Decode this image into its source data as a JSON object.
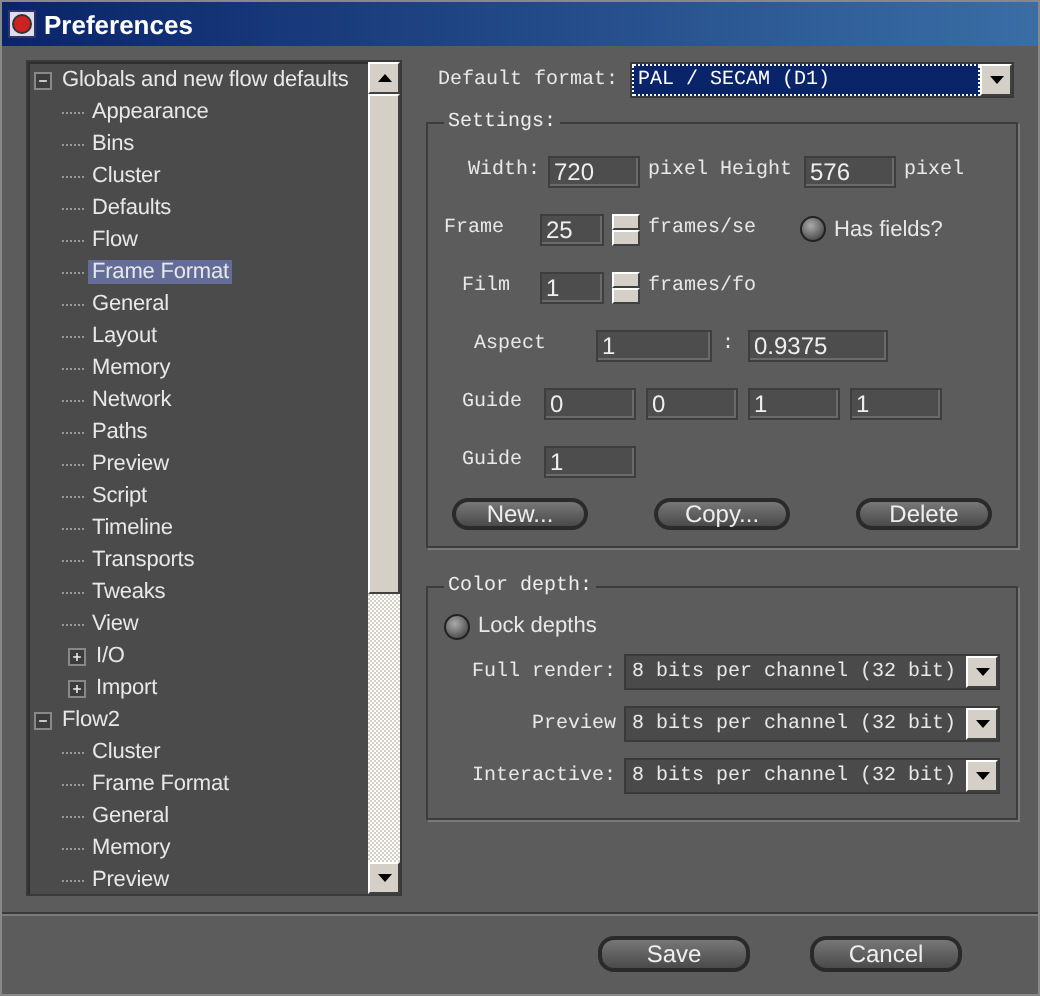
{
  "window": {
    "title": "Preferences"
  },
  "tree": [
    {
      "label": "Globals and new flow defaults",
      "expanded": true,
      "selected": false,
      "children": [
        {
          "label": "Appearance",
          "selected": false
        },
        {
          "label": "Bins",
          "selected": false
        },
        {
          "label": "Cluster",
          "selected": false
        },
        {
          "label": "Defaults",
          "selected": false
        },
        {
          "label": "Flow",
          "selected": false
        },
        {
          "label": "Frame Format",
          "selected": true
        },
        {
          "label": "General",
          "selected": false
        },
        {
          "label": "Layout",
          "selected": false
        },
        {
          "label": "Memory",
          "selected": false
        },
        {
          "label": "Network",
          "selected": false
        },
        {
          "label": "Paths",
          "selected": false
        },
        {
          "label": "Preview",
          "selected": false
        },
        {
          "label": "Script",
          "selected": false
        },
        {
          "label": "Timeline",
          "selected": false
        },
        {
          "label": "Transports",
          "selected": false
        },
        {
          "label": "Tweaks",
          "selected": false
        },
        {
          "label": "View",
          "selected": false
        },
        {
          "label": "I/O",
          "selected": false,
          "expanded": false
        },
        {
          "label": "Import",
          "selected": false,
          "expanded": false
        }
      ]
    },
    {
      "label": "Flow2",
      "expanded": true,
      "selected": false,
      "children": [
        {
          "label": "Cluster",
          "selected": false
        },
        {
          "label": "Frame Format",
          "selected": false
        },
        {
          "label": "General",
          "selected": false
        },
        {
          "label": "Memory",
          "selected": false
        },
        {
          "label": "Preview",
          "selected": false
        }
      ]
    }
  ],
  "default_format": {
    "label": "Default format:",
    "value": "PAL / SECAM (D1)"
  },
  "settings": {
    "title": "Settings:",
    "width": {
      "label": "Width:",
      "value": "720",
      "unit": "pixel"
    },
    "height": {
      "label": "Height",
      "value": "576",
      "unit": "pixel"
    },
    "frame": {
      "label": "Frame",
      "value": "25",
      "unit": "frames/se"
    },
    "has_fields": {
      "label": "Has fields?",
      "checked": false
    },
    "film": {
      "label": "Film",
      "value": "1",
      "unit": "frames/fo"
    },
    "aspect": {
      "label": "Aspect",
      "value_1": "1",
      "separator": ":",
      "value_2": "0.9375"
    },
    "guides": [
      {
        "label": "Guide",
        "values": [
          "0",
          "0",
          "1",
          "1"
        ]
      },
      {
        "label": "Guide",
        "values": [
          "1"
        ]
      }
    ],
    "buttons": [
      "New...",
      "Copy...",
      "Delete"
    ]
  },
  "color_depth": {
    "title": "Color depth:",
    "lock_depths": {
      "label": "Lock depths",
      "checked": false
    },
    "rows": [
      {
        "label": "Full render:",
        "value": "8 bits per channel (32 bit)"
      },
      {
        "label": "Preview",
        "value": "8 bits per channel (32 bit)"
      },
      {
        "label": "Interactive:",
        "value": "8 bits per channel (32 bit)"
      }
    ]
  },
  "buttons": [
    "Save",
    "Cancel"
  ]
}
